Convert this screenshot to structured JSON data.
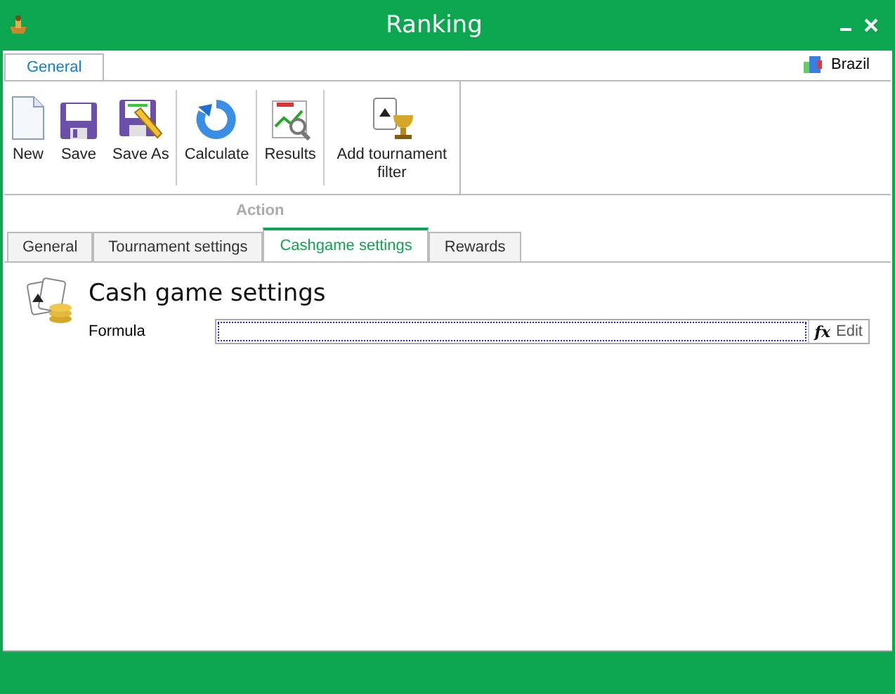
{
  "window": {
    "title": "Ranking"
  },
  "ribbon": {
    "tabs": [
      {
        "label": "General",
        "selected": true
      }
    ],
    "region": "Brazil",
    "group": {
      "label": "Action",
      "disabled": true,
      "clusters": [
        [
          {
            "label": "New",
            "kind": "new"
          },
          {
            "label": "Save",
            "kind": "save"
          },
          {
            "label": "Save As",
            "kind": "saveas"
          }
        ],
        [
          {
            "label": "Calculate",
            "kind": "calculate"
          }
        ],
        [
          {
            "label": "Results",
            "kind": "results"
          }
        ],
        [
          {
            "label": "Add tournament filter",
            "kind": "filter"
          }
        ]
      ]
    }
  },
  "tabs": [
    {
      "label": "General",
      "selected": false
    },
    {
      "label": "Tournament settings",
      "selected": false
    },
    {
      "label": "Cashgame settings",
      "selected": true
    },
    {
      "label": "Rewards",
      "selected": false
    }
  ],
  "panel": {
    "title": "Cash game settings",
    "fields": [
      {
        "label": "Formula",
        "focused": true,
        "button_symbol": "fx",
        "button_label": "Edit"
      }
    ]
  }
}
